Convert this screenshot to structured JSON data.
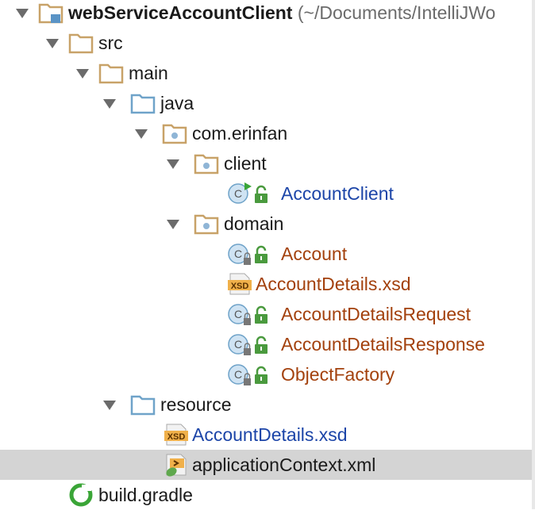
{
  "project": {
    "name": "webServiceAccountClient",
    "path": "(~/Documents/IntelliJWo"
  },
  "tree": {
    "src": "src",
    "main": "main",
    "java": "java",
    "package": "com.erinfan",
    "client": "client",
    "account_client": "AccountClient",
    "domain": "domain",
    "account": "Account",
    "account_details_xsd": "AccountDetails.xsd",
    "account_details_request": "AccountDetailsRequest",
    "account_details_response": "AccountDetailsResponse",
    "object_factory": "ObjectFactory",
    "resource": "resource",
    "resource_xsd": "AccountDetails.xsd",
    "application_context": "applicationContext.xml",
    "build_gradle": "build.gradle"
  },
  "icons": {
    "xsd_badge": "XSD",
    "class_letter": "C"
  },
  "colors": {
    "selected_bg": "#d4d4d4",
    "link_blue": "#1c45a8",
    "error_brown": "#a3410d",
    "folder_tan": "#c8a268",
    "source_blue": "#6fa3c9",
    "lock_green": "#4a9a3e"
  }
}
